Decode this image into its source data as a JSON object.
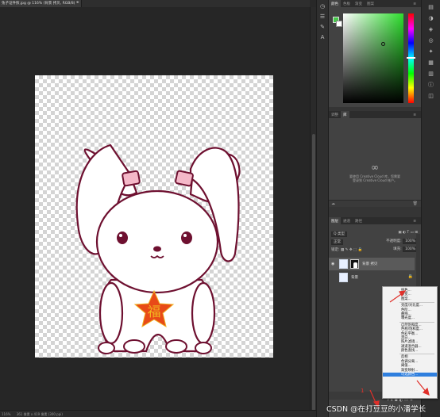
{
  "document": {
    "tab_title": "兔子证件照.jpg @ 116% (背景 拷贝, RGB/8) *",
    "close_symbol": "×",
    "canvas_text": "福"
  },
  "status_bar": {
    "zoom": "116%",
    "doc_size": "361 像素 x 419 像素 (300 ppi)"
  },
  "color_panel": {
    "tabs": [
      "颜色",
      "色板",
      "渐变",
      "图案"
    ],
    "foreground": "#46c84a",
    "background": "#ffffff"
  },
  "libraries_panel": {
    "tabs": [
      "调整",
      "库"
    ],
    "message_line1": "要使用 Creative Cloud 库，您需要",
    "message_line2": "登录到 Creative Cloud 帐户。"
  },
  "layers_panel": {
    "tabs": [
      "图层",
      "通道",
      "路径"
    ],
    "filter_label": "Q 类型",
    "blend_mode": "正常",
    "opacity_label": "不透明度:",
    "opacity_value": "100%",
    "lock_label": "锁定:",
    "fill_label": "填充:",
    "fill_value": "100%",
    "layers": [
      {
        "name": "背景 拷贝",
        "selected": true
      },
      {
        "name": "背景",
        "selected": false
      }
    ]
  },
  "context_menu": {
    "items": [
      "纯色...",
      "渐变...",
      "图案...",
      "---",
      "亮度/对比度...",
      "色阶...",
      "曲线...",
      "曝光度...",
      "---",
      "自然饱和度...",
      "色相/饱和度...",
      "色彩平衡...",
      "黑白...",
      "照片滤镜...",
      "通道混合器...",
      "颜色查找...",
      "---",
      "反相",
      "色调分离...",
      "阈值...",
      "渐变映射...",
      "可选颜色..."
    ],
    "highlighted": "可选颜色..."
  },
  "annotations": {
    "number": "1"
  },
  "watermark": "CSDN @在打豆豆的小潘学长"
}
